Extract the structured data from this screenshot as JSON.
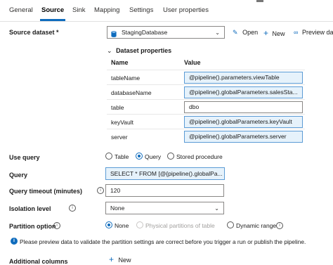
{
  "tabs": [
    "General",
    "Source",
    "Sink",
    "Mapping",
    "Settings",
    "User properties"
  ],
  "source_dataset": {
    "label": "Source dataset",
    "required_mark": "*",
    "value": "StagingDatabase",
    "open_label": "Open",
    "new_label": "New",
    "preview_label": "Preview da"
  },
  "dataset_properties": {
    "title": "Dataset properties",
    "col_name": "Name",
    "col_value": "Value",
    "rows": [
      {
        "name": "tableName",
        "value": "@pipeline().parameters.viewTable"
      },
      {
        "name": "databaseName",
        "value": "@pipeline().globalParameters.salesSta..."
      },
      {
        "name": "table",
        "value": "dbo"
      },
      {
        "name": "keyVault",
        "value": "@pipeline().globalParameters.keyVault"
      },
      {
        "name": "server",
        "value": "@pipeline().globalParameters.server"
      }
    ]
  },
  "use_query": {
    "label": "Use query",
    "options": [
      "Table",
      "Query",
      "Stored procedure"
    ],
    "selected": "Query"
  },
  "query": {
    "label": "Query",
    "value": "SELECT * FROM [@{pipeline().globalPa..."
  },
  "query_timeout": {
    "label": "Query timeout (minutes)",
    "value": "120"
  },
  "isolation_level": {
    "label": "Isolation level",
    "value": "None"
  },
  "partition_option": {
    "label": "Partition option",
    "options": [
      "None",
      "Physical partitions of table",
      "Dynamic range"
    ],
    "selected": "None"
  },
  "notice": "Please preview data to validate the partition settings are correct before you trigger a run or publish the pipeline.",
  "additional_columns": {
    "label": "Additional columns",
    "new_label": "New"
  }
}
